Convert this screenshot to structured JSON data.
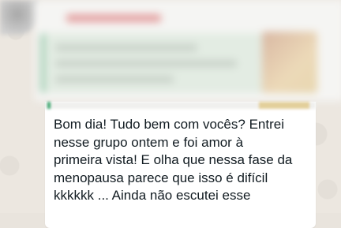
{
  "message": {
    "text": "Bom dia! Tudo bem com vocês? Entrei\nnesse grupo ontem e foi amor à\nprimeira vista! E olha que nessa fase da\nmenopausa parece que isso é difícil\nkkkkkk ... Ainda não escutei esse"
  },
  "colors": {
    "chat_background": "#ece7e0",
    "bubble_background": "#ffffff",
    "quote_accent": "#3aa46c",
    "text": "#111b21"
  }
}
